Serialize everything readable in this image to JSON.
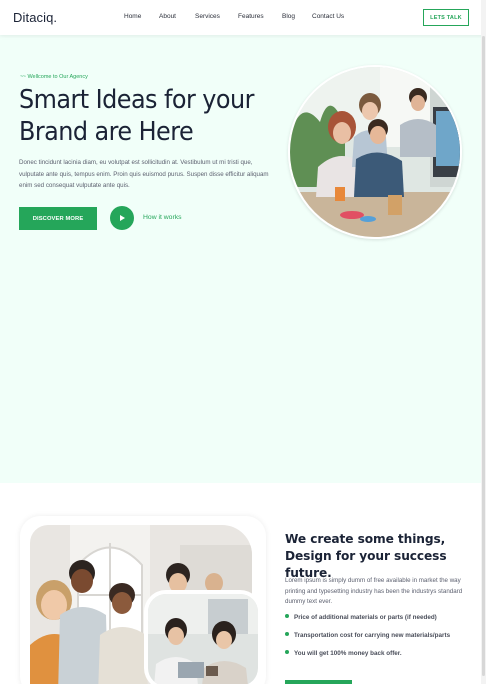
{
  "nav": {
    "brand": "Ditaciq.",
    "links": [
      "Home",
      "About",
      "Services",
      "Features",
      "Blog",
      "Contact Us"
    ],
    "cta": "LETS TALK"
  },
  "hero": {
    "kicker": "Wellcome to Our Agency",
    "title": "Smart Ideas for your Brand are Here",
    "text": "Donec tincidunt lacinia diam, eu volutpat est sollicitudin at. Vestibulum ut mi tristi que, vulputate ante quis, tempus enim. Proin quis euismod purus. Suspen disse efficitur aliquam enim sed consequat vulputate ante quis.",
    "primary_button": "DISCOVER MORE",
    "secondary_link": "How it works",
    "photo_icon": "team-photo"
  },
  "about": {
    "title": "We create some things, Design for your success future.",
    "text": "Lorem ipsum is simply dumm of free available in market the way printing and typesetting industry has been the industrys standard dummy text ever.",
    "bullets": [
      "Price of additional materials or parts (if needed)",
      "Transportation cost for carrying new materials/parts",
      "You will get 100% money back offer."
    ],
    "photo_icon": "group-photo"
  },
  "colors": {
    "accent": "#25a65a",
    "hero_bg": "#f1fff9",
    "heading": "#1b2336"
  }
}
